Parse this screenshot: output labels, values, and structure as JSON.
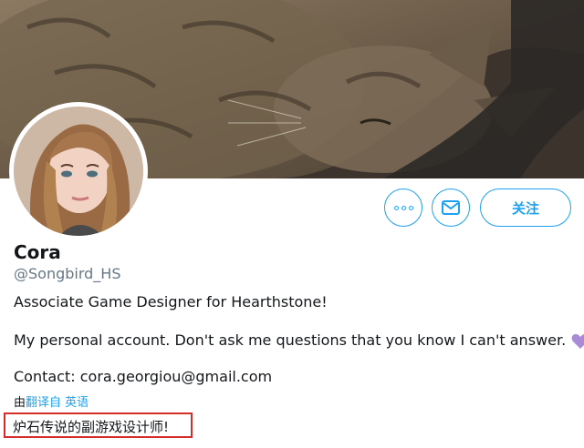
{
  "profile": {
    "name": "Cora",
    "handle": "@Songbird_HS",
    "bio_line1": "Associate Game Designer for Hearthstone!",
    "bio_line2": "My personal account. Don't ask me questions that you know I can't answer.",
    "contact": "Contact: cora.georgiou@gmail.com"
  },
  "actions": {
    "more_icon": "more-dots-icon",
    "dm_icon": "envelope-icon",
    "follow_label": "关注"
  },
  "translation": {
    "prefix": "由",
    "link_label": "翻译自 英语",
    "translated_text": "炉石传说的副游戏设计师!"
  },
  "colors": {
    "accent": "#1da1f2",
    "highlight_box": "#d42b2b",
    "heart": "#a98bd8"
  }
}
